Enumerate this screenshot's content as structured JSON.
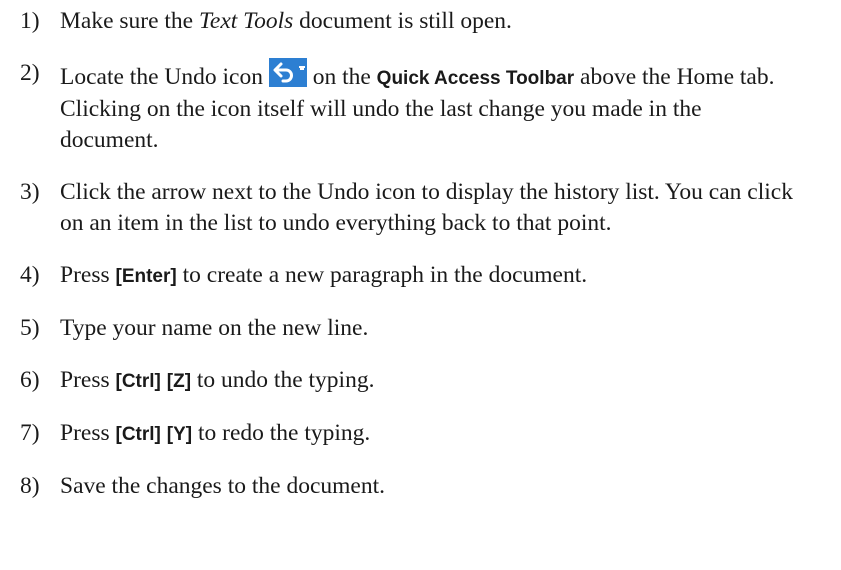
{
  "icons": {
    "undo": "undo-arrow-icon",
    "undo_dropdown": "chevron-down-icon",
    "accent": "#2d7fd2"
  },
  "steps": [
    {
      "num": "1)",
      "pre": "Make sure the ",
      "doc_name": "Text Tools",
      "post": " document is still open."
    },
    {
      "num": "2)",
      "pre": "Locate the Undo icon ",
      "mid": " on the ",
      "ui_label": "Quick Access Toolbar",
      "post": " above the Home tab. Clicking on the icon itself will undo the last change you made in the document."
    },
    {
      "num": "3)",
      "text": "Click the arrow next to the Undo icon to display the history list. You can click on an item in the list to undo everything back to that point."
    },
    {
      "num": "4)",
      "pre": "Press ",
      "key1": "[Enter]",
      "post": " to create a new paragraph in the document."
    },
    {
      "num": "5)",
      "text": "Type your name on the new line."
    },
    {
      "num": "6)",
      "pre": "Press ",
      "key1": "[Ctrl]",
      "key2": "[Z]",
      "post": " to undo the typing."
    },
    {
      "num": "7)",
      "pre": "Press ",
      "key1": "[Ctrl]",
      "key2": "[Y]",
      "post": " to redo the typing."
    },
    {
      "num": "8)",
      "text": "Save the changes to the document."
    }
  ]
}
